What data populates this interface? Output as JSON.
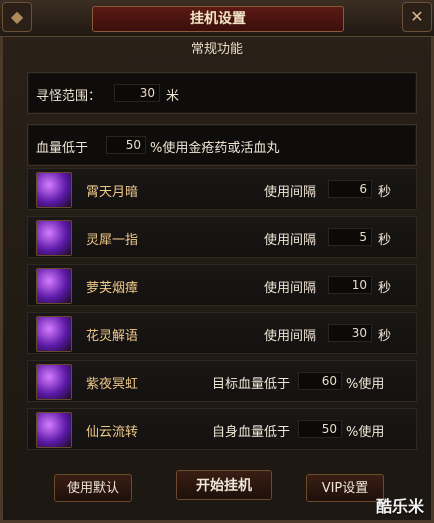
{
  "window": {
    "title": "挂机设置"
  },
  "section": {
    "title": "常规功能"
  },
  "search_range": {
    "label": "寻怪范围：",
    "value": "30",
    "unit": "米"
  },
  "hp_potion": {
    "label": "血量低于",
    "value": "50",
    "suffix": "%使用金疮药或活血丸"
  },
  "skills": [
    {
      "name": "霄天月暗",
      "kind": "interval",
      "label": "使用间隔",
      "value": "6",
      "unit": "秒"
    },
    {
      "name": "灵犀一指",
      "kind": "interval",
      "label": "使用间隔",
      "value": "5",
      "unit": "秒"
    },
    {
      "name": "萝芙烟瘴",
      "kind": "interval",
      "label": "使用间隔",
      "value": "10",
      "unit": "秒"
    },
    {
      "name": "花灵解语",
      "kind": "interval",
      "label": "使用间隔",
      "value": "30",
      "unit": "秒"
    },
    {
      "name": "紫夜冥虹",
      "kind": "hp",
      "label": "目标血量低于",
      "value": "60",
      "unit": "%使用"
    },
    {
      "name": "仙云流转",
      "kind": "hp",
      "label": "自身血量低于",
      "value": "50",
      "unit": "%使用"
    }
  ],
  "buttons": {
    "default": "使用默认",
    "start": "开始挂机",
    "vip": "VIP设置"
  },
  "watermark": "酷乐米"
}
